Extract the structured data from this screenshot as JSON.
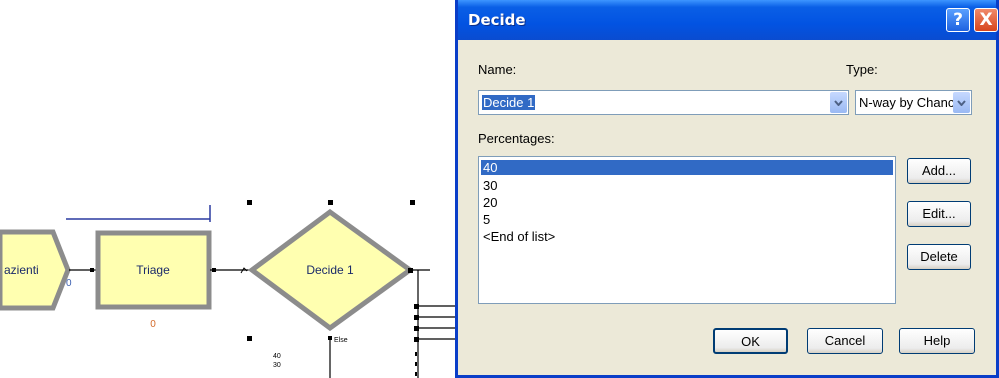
{
  "canvas": {
    "module_pazienti": {
      "label": "azienti",
      "count": "0"
    },
    "module_triage": {
      "label": "Triage",
      "count": "0"
    },
    "module_decide": {
      "label": "Decide 1",
      "else_label": "Else",
      "percent_labels": [
        "40",
        "30"
      ]
    }
  },
  "dialog": {
    "title": "Decide",
    "help_glyph": "?",
    "close_glyph": "X",
    "name_label": "Name:",
    "name_value": "Decide 1",
    "type_label": "Type:",
    "type_value": "N-way by Chance",
    "percentages_label": "Percentages:",
    "percentages": [
      "40",
      "30",
      "20",
      "5",
      "<End of list>"
    ],
    "buttons": {
      "add": "Add...",
      "edit": "Edit...",
      "delete": "Delete",
      "ok": "OK",
      "cancel": "Cancel",
      "help": "Help"
    }
  },
  "colors": {
    "module_fill": "#ffffb0",
    "module_border": "#909090",
    "titlebar": "#0253e2",
    "selection": "#316ac5",
    "dialog_bg": "#ece9d8"
  }
}
